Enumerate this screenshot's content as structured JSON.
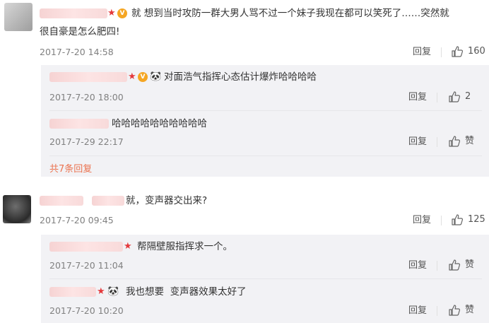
{
  "comments": [
    {
      "text_line1": "就 想到当时攻防一群大男人骂不过一个妹子我现在都可以笑死了……突然就",
      "text_line2": "很自豪是怎么肥四!",
      "time": "2017-7-20 14:58",
      "reply_label": "回复",
      "likes": "160",
      "replies": [
        {
          "text": "对面浩气指挥心态估计爆炸哈哈哈哈",
          "time": "2017-7-20 18:00",
          "reply_label": "回复",
          "likes": "2"
        },
        {
          "text": "哈哈哈哈哈哈哈哈哈哈",
          "time": "2017-7-29 22:17",
          "reply_label": "回复",
          "likes": "赞"
        }
      ],
      "more_replies": "共7条回复"
    },
    {
      "text": "就，变声器交出来?",
      "time": "2017-7-20 09:45",
      "reply_label": "回复",
      "likes": "125",
      "replies": [
        {
          "text": "帮隔壁服指挥求一个。",
          "time": "2017-7-20 11:04",
          "reply_label": "回复",
          "likes": "赞"
        },
        {
          "text": "我也想要  变声器效果太好了",
          "time": "2017-7-20 10:20",
          "reply_label": "回复",
          "likes": "赞"
        }
      ]
    }
  ],
  "badges": {
    "vip_text": "V",
    "panda_icon": "🐼"
  }
}
